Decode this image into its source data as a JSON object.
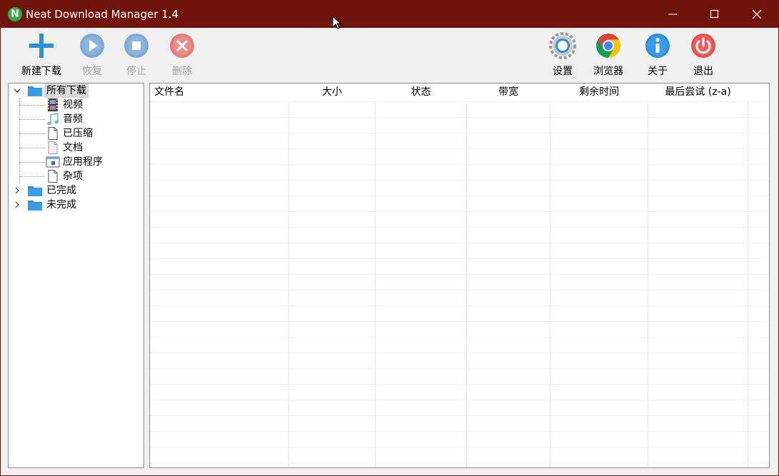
{
  "window": {
    "title": "Neat Download Manager 1.4",
    "logo_letter": "N"
  },
  "toolbar": {
    "new_download": "新建下载",
    "resume": "恢复",
    "stop": "停止",
    "delete": "删除",
    "settings": "设置",
    "browser": "浏览器",
    "about": "关于",
    "exit": "退出"
  },
  "tree": {
    "all_downloads": "所有下载",
    "video": "视频",
    "audio": "音频",
    "compressed": "已压缩",
    "documents": "文档",
    "applications": "应用程序",
    "misc": "杂项",
    "completed": "已完成",
    "incomplete": "未完成"
  },
  "columns": {
    "filename": "文件名",
    "size": "大小",
    "status": "状态",
    "bandwidth": "带宽",
    "time_left": "剩余时间",
    "last_try": "最后尝试 (z-a)"
  },
  "colors": {
    "titlebar": "#6e140b",
    "accent_blue": "#2d8fd8",
    "disabled_blue": "#7ea9d6",
    "delete_red": "#e77b7b",
    "exit_red": "#e84c4c",
    "folder_blue": "#2f8fd9"
  },
  "icons": {
    "new": "plus-icon",
    "resume": "play-icon",
    "stop": "stop-icon",
    "delete": "delete-icon",
    "settings": "gear-icon",
    "browser": "chrome-icon",
    "about": "info-icon",
    "exit": "power-icon"
  }
}
